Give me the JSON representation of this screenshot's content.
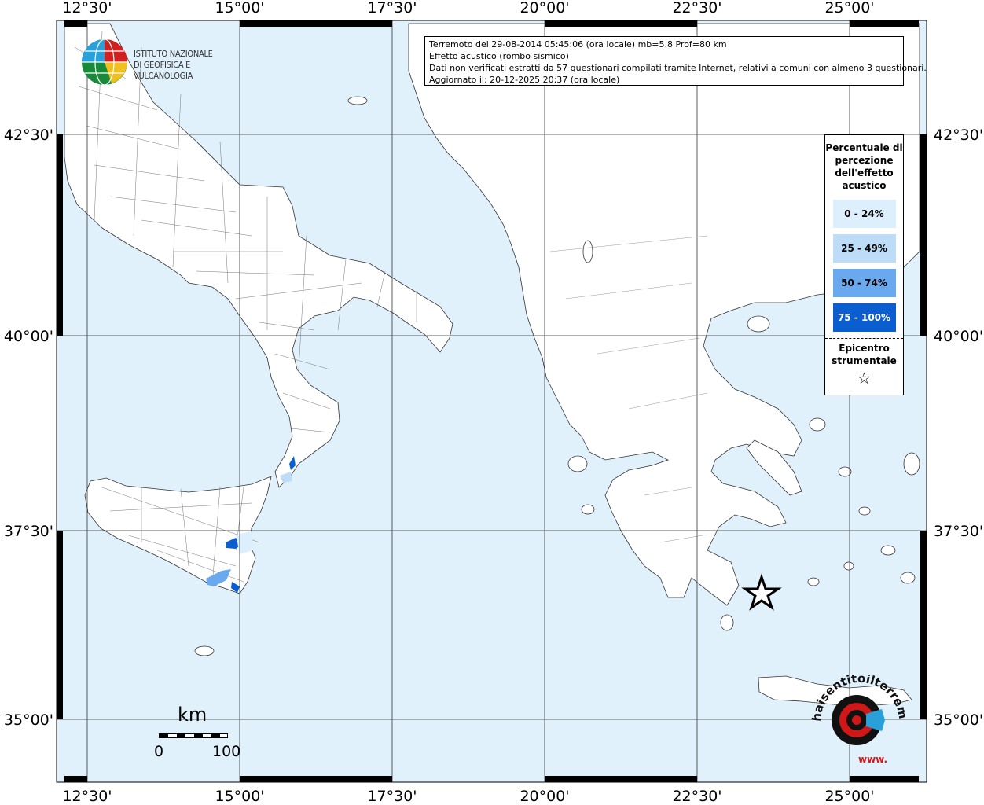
{
  "map": {
    "top_ticks": [
      "12°30'",
      "15°00'",
      "17°30'",
      "20°00'",
      "22°30'",
      "25°00'"
    ],
    "left_ticks": [
      "42°30'",
      "40°00'",
      "37°30'",
      "35°00'"
    ],
    "colors": {
      "sea": "#e0f1fc",
      "land": "#ffffff",
      "border": "#444444",
      "c0_24": "#ddeefc",
      "c25_49": "#bcdcf7",
      "c50_74": "#6aa9ee",
      "c75_100": "#0a5ecf"
    },
    "epicenter_symbol": "star"
  },
  "info": {
    "line1": "Terremoto del 29-08-2014 05:45:06 (ora locale) mb=5.8 Prof=80 km",
    "line2": "Effetto acustico (rombo sismico)",
    "line3": "Dati non verificati estratti da 57 questionari compilati tramite Internet, relativi a comuni con almeno 3 questionari.",
    "line4": "Aggiornato il: 20-12-2025 20:37 (ora locale)"
  },
  "legend": {
    "title": "Percentuale di percezione dell'effetto acustico",
    "classes": [
      "0 - 24%",
      "25 - 49%",
      "50 - 74%",
      "75 - 100%"
    ],
    "epicenter_label": "Epicentro strumentale",
    "epicenter_icon": "star-outline-icon"
  },
  "logo": {
    "line1": "ISTITUTO NAZIONALE",
    "line2": "DI GEOFISICA E VULCANOLOGIA"
  },
  "scale": {
    "unit": "km",
    "start": "0",
    "end": "100"
  },
  "watermark": {
    "text": "haisentitoilterremoto.it",
    "url_prefix": "www."
  }
}
